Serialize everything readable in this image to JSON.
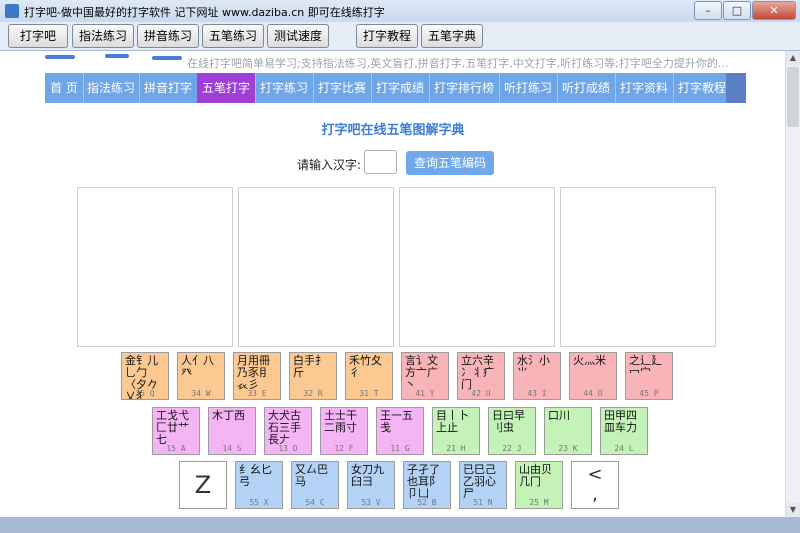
{
  "window": {
    "title": "打字吧-做中国最好的打字软件 记下网址 www.daziba.cn 即可在线练打字",
    "minimize": "–",
    "maximize": "□",
    "close": "✕"
  },
  "toolbar": {
    "buttons": [
      "打字吧",
      "指法练习",
      "拼音练习",
      "五笔练习",
      "测试速度",
      "打字教程",
      "五笔字典"
    ]
  },
  "page": {
    "slogan": "在线打字吧简单易学习;支持指法练习,英文盲打,拼音打字,五笔打字,中文打字,听打练习等;打字吧全力提升你的...",
    "nav": [
      "首 页",
      "指法练习",
      "拼音打字",
      "五笔打字",
      "打字练习",
      "打字比赛",
      "打字成绩",
      "打字排行榜",
      "听打练习",
      "听打成绩",
      "打字资料",
      "打字教程"
    ],
    "nav_active_index": 3,
    "heading": "打字吧在线五笔图解字典",
    "query_label": "请输入汉字:",
    "query_value": "",
    "query_button": "查询五笔编码"
  },
  "keyboard": {
    "colors": {
      "orange": "#fcc992",
      "pink": "#f9b4b8",
      "magenta": "#f4b4f5",
      "green": "#c3f3b6",
      "blue": "#b3d2f6"
    },
    "row1": [
      {
        "roots": "金钅儿乚勹〈夕𠂊乂犭",
        "code": "35 Q",
        "color": "orange"
      },
      {
        "roots": "人亻八癶",
        "code": "34 W",
        "color": "orange"
      },
      {
        "roots": "月用冊乃豕⺝𧘇彡",
        "code": "33 E",
        "color": "orange"
      },
      {
        "roots": "白手扌斤",
        "code": "32 R",
        "color": "orange"
      },
      {
        "roots": "禾竹夂彳",
        "code": "31 T",
        "color": "orange"
      },
      {
        "roots": "言讠文方亠广丶",
        "code": "41 Y",
        "color": "pink"
      },
      {
        "roots": "立六辛冫丬疒门",
        "code": "42 U",
        "color": "pink"
      },
      {
        "roots": "水氵小⺌",
        "code": "43 I",
        "color": "pink"
      },
      {
        "roots": "火灬米",
        "code": "44 O",
        "color": "pink"
      },
      {
        "roots": "之辶廴冖宀",
        "code": "45 P",
        "color": "pink"
      }
    ],
    "row2": [
      {
        "roots": "工戈弋匚廿艹七",
        "code": "15 A",
        "color": "magenta"
      },
      {
        "roots": "木丁西",
        "code": "14 S",
        "color": "magenta"
      },
      {
        "roots": "大犬古石三手長𠂇",
        "code": "13 D",
        "color": "magenta"
      },
      {
        "roots": "土士干二雨寸",
        "code": "12 F",
        "color": "magenta"
      },
      {
        "roots": "王一五戋",
        "code": "11 G",
        "color": "magenta"
      },
      {
        "roots": "目丨卜上止",
        "code": "21 H",
        "color": "green"
      },
      {
        "roots": "日曰早刂虫",
        "code": "22 J",
        "color": "green"
      },
      {
        "roots": "口川",
        "code": "23 K",
        "color": "green"
      },
      {
        "roots": "田甲四皿车力",
        "code": "24 L",
        "color": "green"
      }
    ],
    "row3": [
      {
        "big": "Z",
        "color": "white"
      },
      {
        "roots": "纟幺匕弓",
        "code": "55 X",
        "color": "blue"
      },
      {
        "roots": "又厶巴马",
        "code": "54 C",
        "color": "blue"
      },
      {
        "roots": "女刀九臼彐",
        "code": "53 V",
        "color": "blue"
      },
      {
        "roots": "子孑了也耳阝卩凵",
        "code": "52 B",
        "color": "blue"
      },
      {
        "roots": "已巳己乙羽心尸",
        "code": "51 N",
        "color": "blue"
      },
      {
        "roots": "山由贝几冂",
        "code": "25 M",
        "color": "green"
      },
      {
        "big": "<\n,",
        "color": "white"
      }
    ]
  }
}
